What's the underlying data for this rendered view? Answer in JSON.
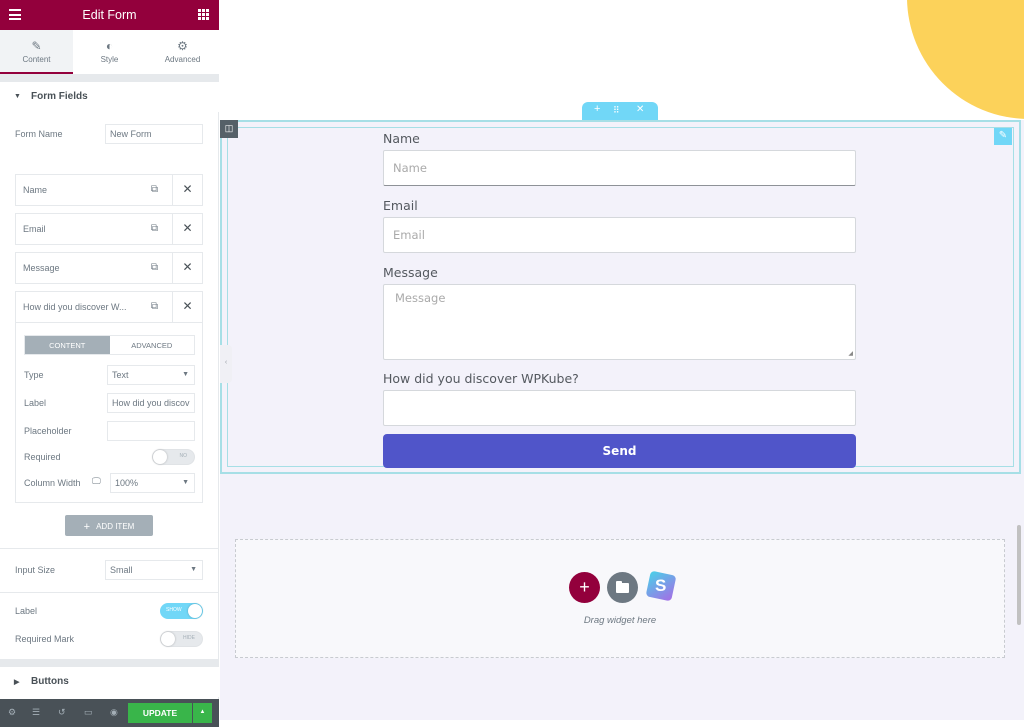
{
  "panel": {
    "header": {
      "title": "Edit Form",
      "menu_icon": "hamburger-icon",
      "apps_icon": "grid-icon"
    },
    "tabs": [
      {
        "label": "Content",
        "icon": "pencil-icon",
        "active": true
      },
      {
        "label": "Style",
        "icon": "half-circle-icon",
        "active": false
      },
      {
        "label": "Advanced",
        "icon": "gear-icon",
        "active": false
      }
    ],
    "form_fields_section": {
      "title": "Form Fields",
      "form_name_label": "Form Name",
      "form_name_value": "New Form",
      "items": [
        {
          "title": "Name"
        },
        {
          "title": "Email"
        },
        {
          "title": "Message"
        },
        {
          "title": "How did you discover W..."
        }
      ],
      "open_item": {
        "tabs": [
          "CONTENT",
          "ADVANCED"
        ],
        "active_tab": "CONTENT",
        "type_label": "Type",
        "type_value": "Text",
        "label_label": "Label",
        "label_value": "How did you discov",
        "placeholder_label": "Placeholder",
        "placeholder_value": "",
        "required_label": "Required",
        "required_toggle": {
          "state": "off",
          "text": "NO"
        },
        "column_width_label": "Column Width",
        "column_width_value": "100%"
      },
      "add_item_label": "ADD ITEM"
    },
    "input_size_label": "Input Size",
    "input_size_value": "Small",
    "label_switch": {
      "label": "Label",
      "state": "on",
      "text": "SHOW"
    },
    "required_mark_switch": {
      "label": "Required Mark",
      "state": "off",
      "text": "HIDE"
    },
    "buttons_section_title": "Buttons",
    "footer": {
      "icons": [
        "settings-icon",
        "layers-icon",
        "history-icon",
        "responsive-icon",
        "preview-icon"
      ],
      "update_label": "UPDATE"
    }
  },
  "canvas": {
    "form": {
      "fields": [
        {
          "label": "Name",
          "placeholder": "Name",
          "type": "text"
        },
        {
          "label": "Email",
          "placeholder": "Email",
          "type": "email"
        },
        {
          "label": "Message",
          "placeholder": "Message",
          "type": "textarea"
        },
        {
          "label": "How did you discover WPKube?",
          "placeholder": "",
          "type": "text"
        }
      ],
      "submit_label": "Send"
    },
    "drop_zone": {
      "text": "Drag widget here"
    },
    "colors": {
      "brand": "#93003c",
      "accent": "#71d7f7",
      "submit": "#5055c9",
      "update": "#39b54a",
      "decor_circle": "#fcd25a"
    }
  }
}
